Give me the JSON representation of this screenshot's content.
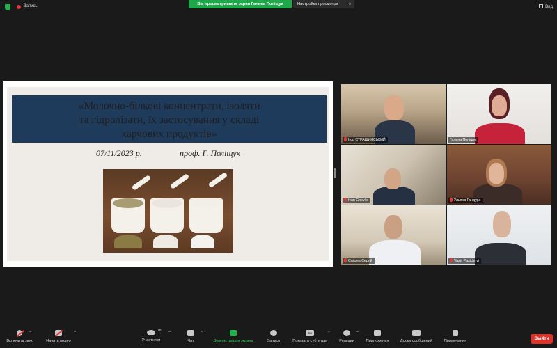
{
  "top_bar": {
    "recording_label": "Запись",
    "share_banner": "Вы просматриваете экран Галина Поліщук",
    "view_settings": "Настройки просмотра",
    "view_button": "Вид"
  },
  "slide": {
    "title": "«Молочно-білкові концентрати,  ізоляти\nта гідролізати, їх застосування у складі\nхарчових продуктів»",
    "date": "07/11/2023 р.",
    "author": "проф. Г. Поліщук"
  },
  "participants": [
    {
      "name": "Ігор СТРАШИНСЬКИЙ",
      "muted": true
    },
    {
      "name": "Галина Поліщук",
      "muted": false,
      "active_speaker": true
    },
    {
      "name": "Ivan Gnevko",
      "muted": true
    },
    {
      "name": "Ульяна Гандура",
      "muted": true
    },
    {
      "name": "Єліщев Сергій",
      "muted": true
    },
    {
      "name": "Vasyl Pasichnyi",
      "muted": true
    }
  ],
  "toolbar": {
    "unmute": "Включить звук",
    "start_video": "Начать видео",
    "participants": "Участники",
    "participants_count": "78",
    "chat": "Чат",
    "share_screen": "Демонстрация экрана",
    "record": "Запись",
    "captions": "Показать субтитры",
    "captions_icon": "CC",
    "reactions": "Реакции",
    "apps": "Приложения",
    "whiteboards": "Доски сообщений",
    "notes": "Примечания",
    "end": "Выйти"
  },
  "colors": {
    "share_banner": "#1fa84a",
    "end_button": "#d9342b",
    "slide_title_bar": "#1f3b5c",
    "speaker_outline": "#c8d84a"
  }
}
